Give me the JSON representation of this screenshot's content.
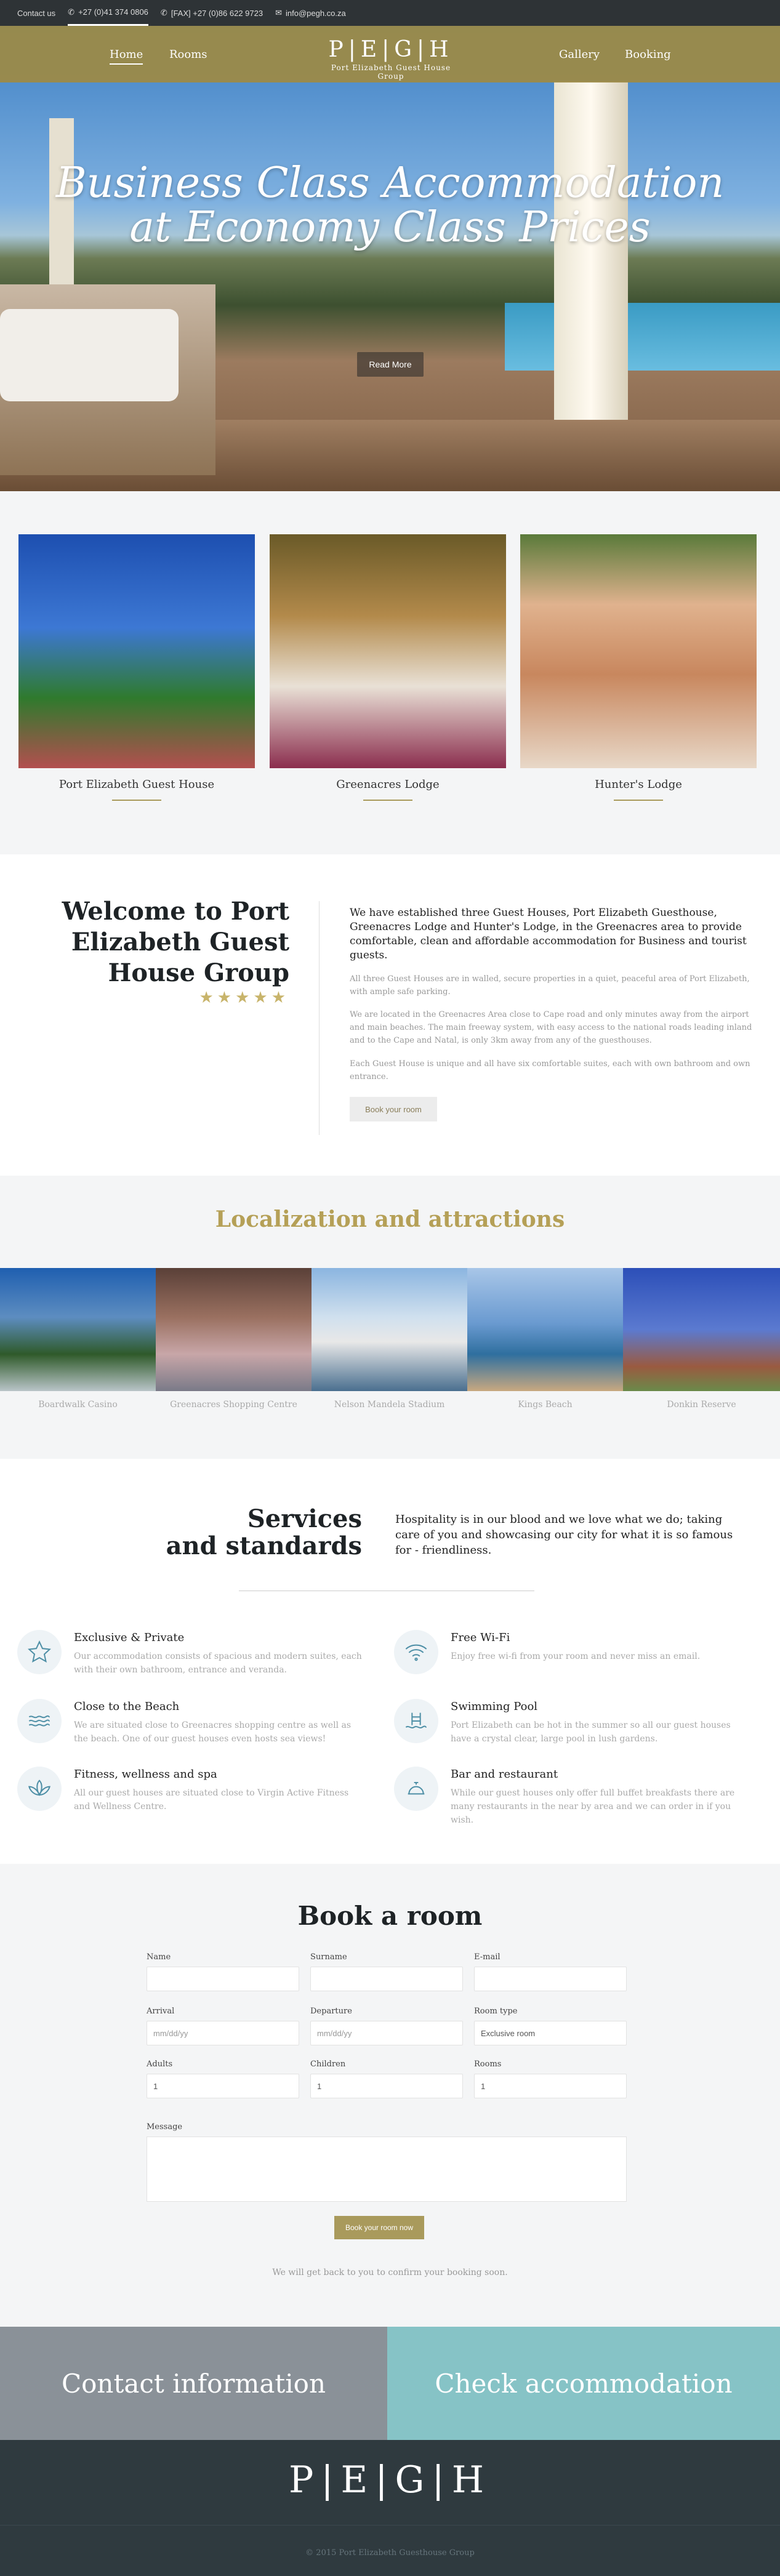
{
  "topbar": {
    "contact": "Contact us",
    "phone": "+27 (0)41 374 0806",
    "fax": "[FAX] +27 (0)86 622 9723",
    "email": "info@pegh.co.za"
  },
  "nav": {
    "home": "Home",
    "rooms": "Rooms",
    "gallery": "Gallery",
    "booking": "Booking",
    "logo_mark": "P|E|G|H",
    "logo_sub": "Port Elizabeth Guest House Group"
  },
  "hero": {
    "title_line1": "Business Class Accommodation",
    "title_line2": "at Economy Class Prices",
    "button": "Read More"
  },
  "houses": [
    {
      "name": "Port Elizabeth Guest House",
      "color": "#3b8a3a"
    },
    {
      "name": "Greenacres Lodge",
      "color": "#b38a4b"
    },
    {
      "name": "Hunter's Lodge",
      "color": "#c49a6c"
    }
  ],
  "welcome": {
    "title": "Welcome to Port Elizabeth Guest House Group",
    "stars": "★★★★★",
    "lead": "We have established three Guest Houses, Port Elizabeth Guesthouse, Greenacres Lodge and Hunter's Lodge, in the Greenacres area to provide comfortable, clean and affordable accommodation for Business and tourist guests.",
    "p1": "All three Guest Houses are in walled, secure properties in a quiet, peaceful area of Port Elizabeth, with ample safe parking.",
    "p2": "We are located in the Greenacres Area close to Cape road and only minutes away from the airport and main beaches. The main freeway system, with easy access to the national roads leading inland and to the Cape and Natal, is only 3km away from any of the guesthouses.",
    "p3": "Each Guest House is unique and all have six comfortable suites, each with own bathroom and own entrance.",
    "button": "Book your room"
  },
  "localization": {
    "title": "Localization and attractions",
    "items": [
      {
        "name": "Boardwalk Casino"
      },
      {
        "name": "Greenacres Shopping Centre"
      },
      {
        "name": "Nelson Mandela Stadium"
      },
      {
        "name": "Kings Beach"
      },
      {
        "name": "Donkin Reserve"
      }
    ]
  },
  "services": {
    "title_line1": "Services",
    "title_line2": "and standards",
    "lead": "Hospitality is in our blood and we love what we do; taking care of you and showcasing our city for what it is so famous for - friendliness.",
    "items": [
      {
        "title": "Exclusive & Private",
        "text": "Our accommodation consists of spacious and modern suites, each with their own bathroom, entrance and veranda.",
        "icon": "star-icon"
      },
      {
        "title": "Free Wi-Fi",
        "text": "Enjoy free wi-fi from your room and never miss an email.",
        "icon": "wifi-icon"
      },
      {
        "title": "Close to the Beach",
        "text": "We are situated close to Greenacres shopping centre as well as the beach. One of our guest houses even hosts sea views!",
        "icon": "waves-icon"
      },
      {
        "title": "Swimming Pool",
        "text": "Port Elizabeth can be hot in the summer so all our guest houses have a crystal clear, large pool in lush gardens.",
        "icon": "pool-icon"
      },
      {
        "title": "Fitness, wellness and spa",
        "text": "All our guest houses are situated close to Virgin Active Fitness and Wellness Centre.",
        "icon": "lotus-icon"
      },
      {
        "title": "Bar and restaurant",
        "text": "While our guest houses only offer full buffet breakfasts there are many restaurants in the near by area and we can order in if you wish.",
        "icon": "bell-icon"
      }
    ]
  },
  "booking": {
    "title": "Book a room",
    "labels": {
      "name": "Name",
      "surname": "Surname",
      "email": "E-mail",
      "arrival": "Arrival",
      "departure": "Departure",
      "room_type": "Room type",
      "adults": "Adults",
      "children": "Children",
      "rooms": "Rooms",
      "message": "Message"
    },
    "placeholders": {
      "arrival": "mm/dd/yy",
      "departure": "mm/dd/yy"
    },
    "values": {
      "room_type": "Exclusive room",
      "adults": "1",
      "children": "1",
      "rooms": "1"
    },
    "submit": "Book your room now",
    "note": "We will get back to you to confirm your booking soon."
  },
  "cta": {
    "contact": "Contact information",
    "check": "Check accommodation",
    "contact_bg": "#8a9198",
    "check_bg": "#86c3c6"
  },
  "footer": {
    "logo": "P|E|G|H",
    "copyright": "© 2015 Port Elizabeth Guesthouse Group"
  }
}
